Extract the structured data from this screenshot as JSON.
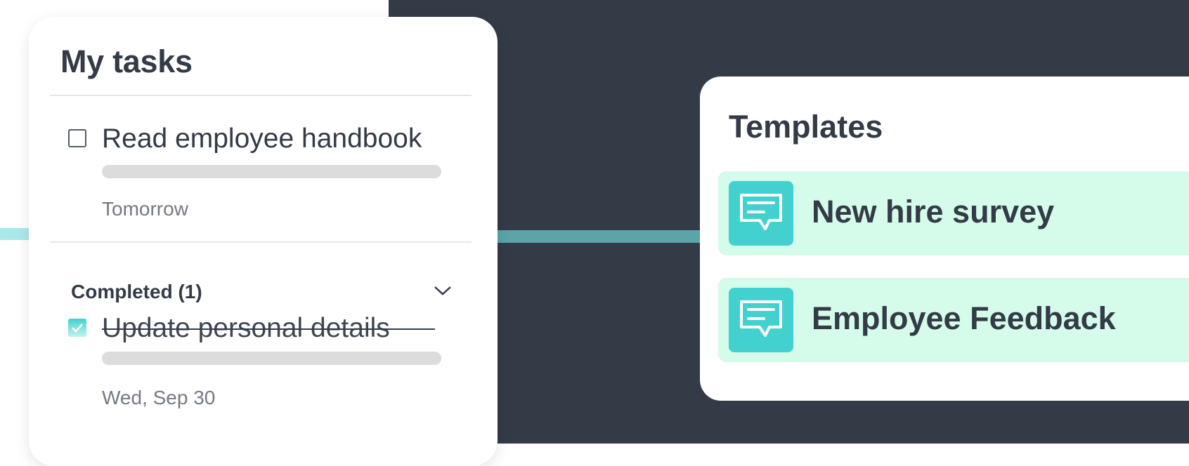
{
  "tasks": {
    "title": "My tasks",
    "open_task": {
      "label": "Read employee handbook",
      "due": "Tomorrow",
      "checked": false
    },
    "completed": {
      "heading": "Completed (1)",
      "items": [
        {
          "label": "Update personal details",
          "due": "Wed, Sep 30",
          "checked": true
        }
      ]
    }
  },
  "templates": {
    "title": "Templates",
    "items": [
      {
        "label": "New hire survey",
        "icon": "chat-bubble-icon"
      },
      {
        "label": "Employee Feedback",
        "icon": "chat-bubble-icon"
      }
    ]
  },
  "colors": {
    "dark_background": "#333b47",
    "accent_teal": "#42d1cf",
    "template_row": "#d5fbea",
    "connector": "#5aa4aa"
  }
}
